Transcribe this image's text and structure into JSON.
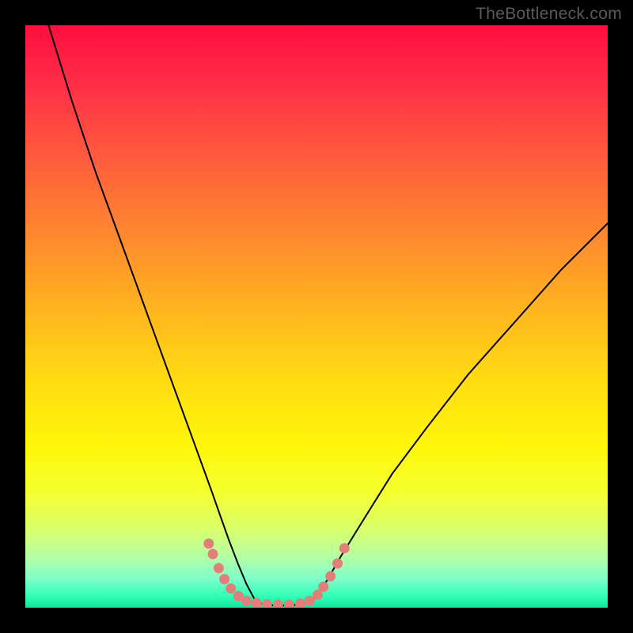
{
  "attribution": "TheBottleneck.com",
  "colors": {
    "curve_stroke": "#000000",
    "marker_fill": "#e27f7a",
    "marker_stroke": "#e27f7a"
  },
  "chart_data": {
    "type": "line",
    "title": "",
    "xlabel": "",
    "ylabel": "",
    "xlim": [
      0,
      100
    ],
    "ylim": [
      0,
      100
    ],
    "grid": false,
    "legend": false,
    "series": [
      {
        "name": "left-branch",
        "x": [
          4,
          8,
          12,
          16,
          20,
          24,
          28,
          30,
          32,
          33.5,
          35,
          36.5,
          38,
          39.5
        ],
        "y": [
          100,
          87,
          75,
          64,
          53,
          42,
          31,
          25.5,
          20,
          15.7,
          11.5,
          7.6,
          4.0,
          1.2
        ]
      },
      {
        "name": "floor",
        "x": [
          39.5,
          41,
          43,
          45,
          47,
          49
        ],
        "y": [
          1.2,
          0.5,
          0.4,
          0.4,
          0.5,
          1.0
        ]
      },
      {
        "name": "right-branch",
        "x": [
          49,
          50.5,
          52,
          54,
          58,
          63,
          69,
          76,
          84,
          92,
          100
        ],
        "y": [
          1.0,
          2.6,
          5.0,
          8.5,
          15,
          23,
          31,
          40,
          49,
          58,
          66
        ]
      }
    ],
    "markers": [
      {
        "x": 31.5,
        "y": 11.0,
        "r": 6
      },
      {
        "x": 32.2,
        "y": 9.2,
        "r": 6
      },
      {
        "x": 33.2,
        "y": 6.8,
        "r": 6
      },
      {
        "x": 34.2,
        "y": 4.9,
        "r": 6
      },
      {
        "x": 35.3,
        "y": 3.3,
        "r": 6
      },
      {
        "x": 36.6,
        "y": 2.0,
        "r": 6
      },
      {
        "x": 38.0,
        "y": 1.2,
        "r": 6
      },
      {
        "x": 39.7,
        "y": 0.8,
        "r": 6
      },
      {
        "x": 41.5,
        "y": 0.6,
        "r": 6
      },
      {
        "x": 43.4,
        "y": 0.5,
        "r": 6
      },
      {
        "x": 45.3,
        "y": 0.5,
        "r": 6
      },
      {
        "x": 47.2,
        "y": 0.7,
        "r": 6
      },
      {
        "x": 48.8,
        "y": 1.2,
        "r": 6
      },
      {
        "x": 50.2,
        "y": 2.2,
        "r": 6
      },
      {
        "x": 51.2,
        "y": 3.6,
        "r": 6
      },
      {
        "x": 52.4,
        "y": 5.4,
        "r": 6
      },
      {
        "x": 53.6,
        "y": 7.6,
        "r": 6
      },
      {
        "x": 54.8,
        "y": 10.2,
        "r": 6
      }
    ]
  }
}
